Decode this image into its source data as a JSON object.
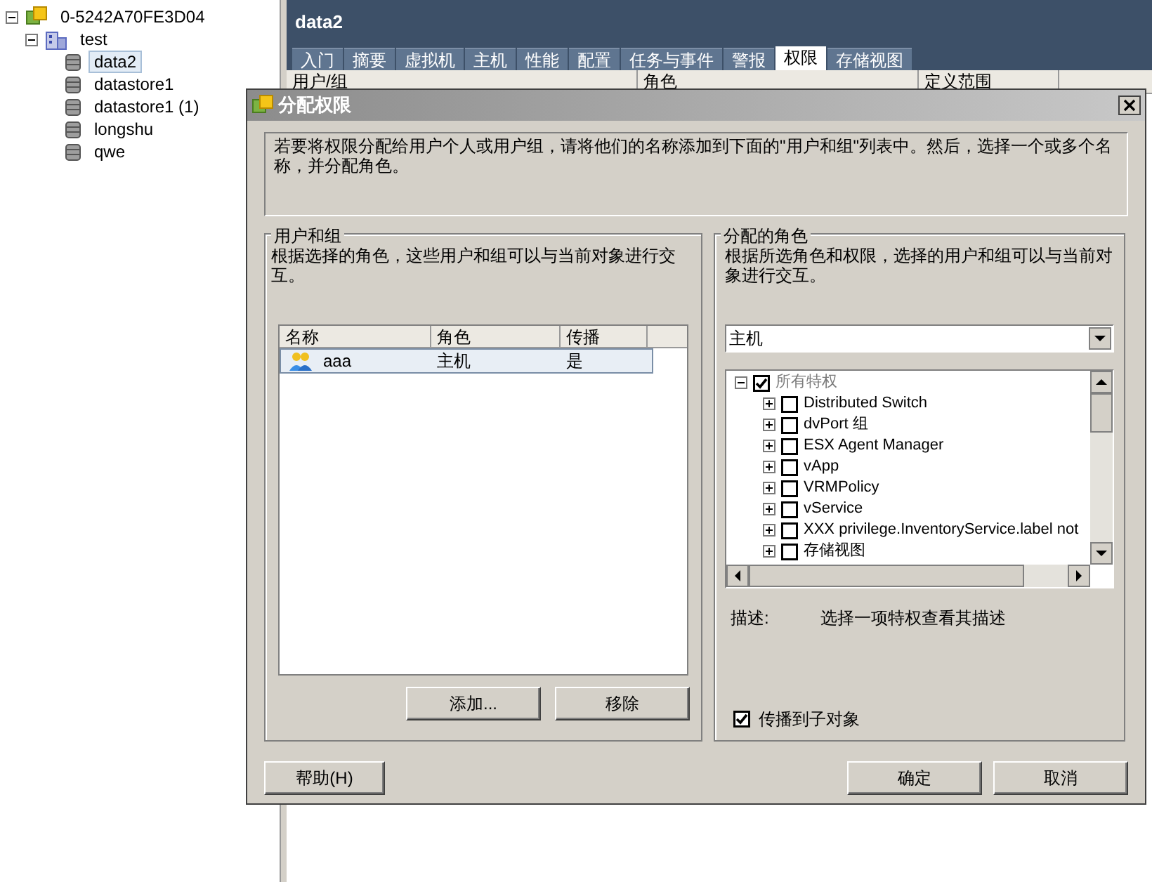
{
  "tree": [
    {
      "label": "0-5242A70FE3D04",
      "kind": "vcenter",
      "expanded": true,
      "selected": false,
      "children": [
        {
          "label": "test",
          "kind": "datacenter",
          "expanded": true,
          "selected": false,
          "children": [
            {
              "label": "data2",
              "kind": "datastore",
              "selected": true
            },
            {
              "label": "datastore1",
              "kind": "datastore",
              "selected": false
            },
            {
              "label": "datastore1 (1)",
              "kind": "datastore",
              "selected": false
            },
            {
              "label": "longshu",
              "kind": "datastore",
              "selected": false
            },
            {
              "label": "qwe",
              "kind": "datastore",
              "selected": false
            }
          ]
        }
      ]
    }
  ],
  "header": {
    "title": "data2"
  },
  "tabs": [
    {
      "label": "入门",
      "selected": false
    },
    {
      "label": "摘要",
      "selected": false
    },
    {
      "label": "虚拟机",
      "selected": false
    },
    {
      "label": "主机",
      "selected": false
    },
    {
      "label": "性能",
      "selected": false
    },
    {
      "label": "配置",
      "selected": false
    },
    {
      "label": "任务与事件",
      "selected": false
    },
    {
      "label": "警报",
      "selected": false
    },
    {
      "label": "权限",
      "selected": true
    },
    {
      "label": "存储视图",
      "selected": false
    }
  ],
  "table": {
    "columns": [
      "用户/组",
      "角色",
      "定义范围"
    ]
  },
  "dialog": {
    "title": "分配权限",
    "intro": "若要将权限分配给用户个人或用户组，请将他们的名称添加到下面的\"用户和组\"列表中。然后，选择一个或多个名称，并分配角色。",
    "users_groups": {
      "title": "用户和组",
      "description": "根据选择的角色，这些用户和组可以与当前对象进行交互。",
      "columns": [
        "名称",
        "角色",
        "传播"
      ],
      "rows": [
        {
          "name": "aaa",
          "role": "主机",
          "propagate": "是",
          "selected": true
        }
      ],
      "buttons": [
        "添加...",
        "移除"
      ]
    },
    "roles": {
      "title": "分配的角色",
      "description": "根据所选角色和权限，选择的用户和组可以与当前对象进行交互。",
      "role_select": {
        "value": "主机"
      },
      "privileges": [
        {
          "label": "所有特权",
          "checked": true,
          "expanded": true,
          "children": [
            {
              "label": "Distributed Switch",
              "checked": false,
              "expanded": false
            },
            {
              "label": "dvPort 组",
              "checked": false,
              "expanded": false
            },
            {
              "label": "ESX Agent Manager",
              "checked": false,
              "expanded": false
            },
            {
              "label": "vApp",
              "checked": false,
              "expanded": false
            },
            {
              "label": "VRMPolicy",
              "checked": false,
              "expanded": false
            },
            {
              "label": "vService",
              "checked": false,
              "expanded": false
            },
            {
              "label": "XXX privilege.InventoryService.label not",
              "checked": false,
              "expanded": false
            },
            {
              "label": "存储视图",
              "checked": false,
              "expanded": false
            }
          ]
        }
      ],
      "description_label": "描述:",
      "description_text": "选择一项特权查看其描述",
      "propagate": {
        "label": "传播到子对象",
        "checked": true
      }
    },
    "buttons": {
      "help": "帮助(H)",
      "ok": "确定",
      "cancel": "取消"
    }
  }
}
